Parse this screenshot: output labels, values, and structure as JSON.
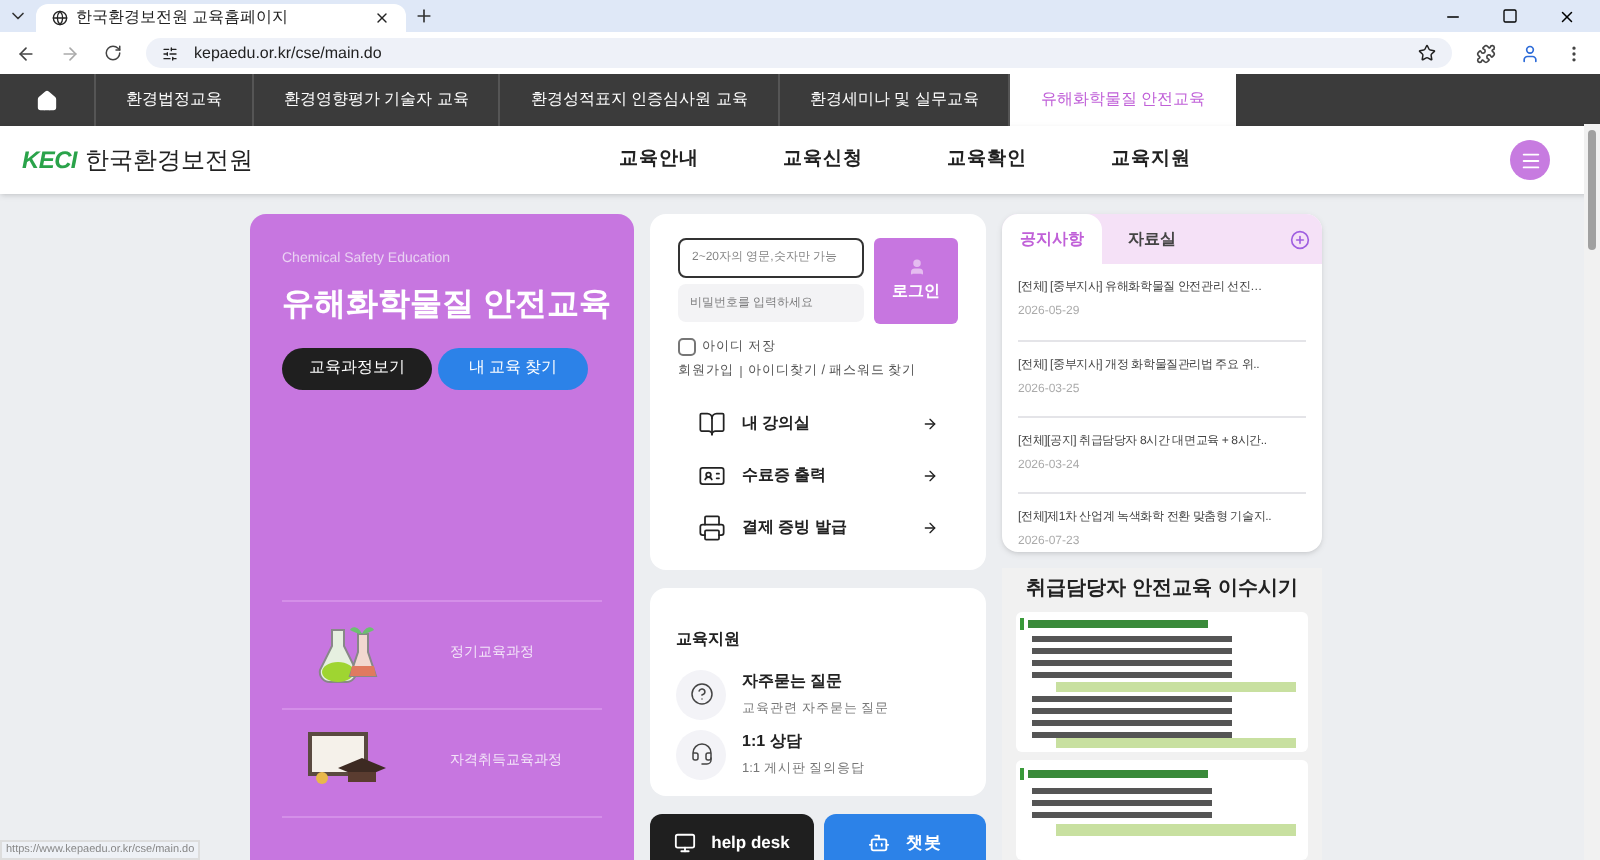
{
  "browser": {
    "tab_title": "한국환경보전원 교육홈페이지",
    "url": "kepaedu.or.kr/cse/main.do",
    "status_url": "https://www.kepaedu.or.kr/cse/main.do"
  },
  "nav": {
    "items": [
      {
        "label": "환경법정교육",
        "selected": false
      },
      {
        "label": "환경영향평가 기술자 교육",
        "selected": false
      },
      {
        "label": "환경성적표지 인증심사원 교육",
        "selected": false
      },
      {
        "label": "환경세미나 및 실무교육",
        "selected": false
      },
      {
        "label": "유해화학물질 안전교육",
        "selected": true
      }
    ]
  },
  "header": {
    "logo_mark": "KECI",
    "logo_text": "한국환경보전원",
    "menu": [
      "교육안내",
      "교육신청",
      "교육확인",
      "교육지원"
    ]
  },
  "hero": {
    "subtitle": "Chemical Safety Education",
    "title": "유해화학물질 안전교육",
    "buttons": [
      {
        "label": "교육과정보기",
        "kind": "dark"
      },
      {
        "label": "내 교육 찾기",
        "kind": "blue"
      }
    ],
    "courses": [
      {
        "label": "정기교육과정",
        "kind": "flask"
      },
      {
        "label": "자격취득교육과정",
        "kind": "diploma"
      }
    ]
  },
  "login": {
    "id_placeholder": "2~20자의 영문,숫자만 가능",
    "pw_placeholder": "비밀번호를 입력하세요",
    "button": "로그인",
    "remember": {
      "label": "아이디 저장",
      "checked": false
    },
    "links": [
      "회원가입",
      "아이디찾기 / 패스워드 찾기"
    ],
    "shortcuts": [
      {
        "label": "내 강의실",
        "kind": "book"
      },
      {
        "label": "수료증 출력",
        "kind": "card"
      },
      {
        "label": "결제 증빙 발급",
        "kind": "printer"
      }
    ]
  },
  "support": {
    "title": "교육지원",
    "items": [
      {
        "title": "자주묻는 질문",
        "desc": "교육관련 자주묻는 질문",
        "kind": "faq"
      },
      {
        "title": "1:1 상담",
        "desc": "1:1 게시판 질의응답",
        "kind": "headset"
      }
    ]
  },
  "quick": [
    {
      "label": "help desk",
      "kind": "dark"
    },
    {
      "label": "챗봇",
      "kind": "blue"
    }
  ],
  "notices": {
    "tabs": [
      {
        "label": "공지사항",
        "selected": true
      },
      {
        "label": "자료실",
        "selected": false
      }
    ],
    "items": [
      {
        "title": "[전체] [중부지사] 유해화학물질 안전관리 선진…",
        "date": "2026-05-29"
      },
      {
        "title": "[전체] [중부지사] 개정 화학물질관리법 주요 위..",
        "date": "2026-03-25"
      },
      {
        "title": "[전체][공지] 취급담당자 8시간 대면교육 + 8시간..",
        "date": "2026-03-24"
      },
      {
        "title": "[전체]제1차 산업계 녹색화학 전환 맞춤형 기술지..",
        "date": "2026-07-23"
      }
    ]
  },
  "poster": {
    "title": "취급담당자 안전교육 이수시기"
  }
}
